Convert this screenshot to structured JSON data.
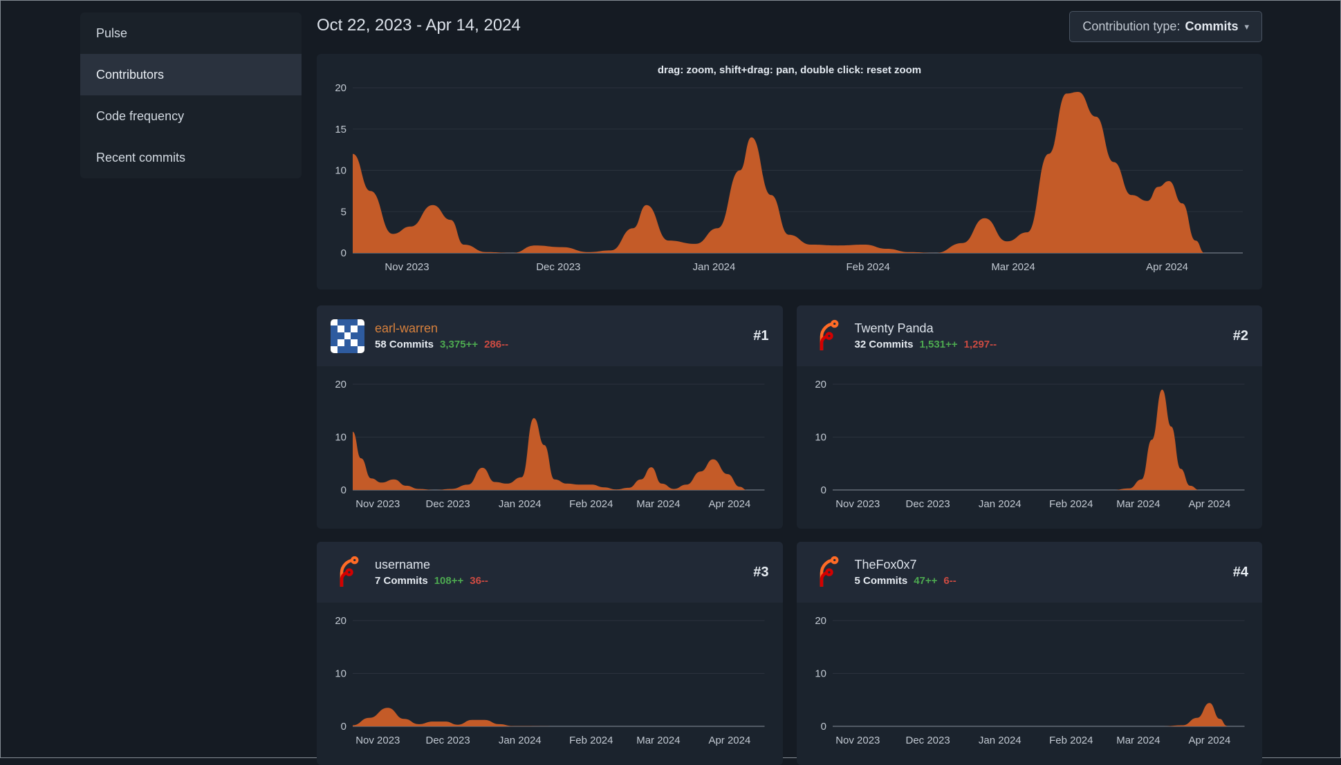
{
  "sidebar": {
    "items": [
      {
        "label": "Pulse",
        "active": false
      },
      {
        "label": "Contributors",
        "active": true
      },
      {
        "label": "Code frequency",
        "active": false
      },
      {
        "label": "Recent commits",
        "active": false
      }
    ]
  },
  "header": {
    "date_range": "Oct 22, 2023 - Apr 14, 2024",
    "contribution_type": {
      "label": "Contribution type:",
      "value": "Commits"
    }
  },
  "main_chart": {
    "hint": "drag: zoom, shift+drag: pan, double click: reset zoom"
  },
  "contributors": [
    {
      "rank": "#1",
      "name": "earl-warren",
      "commits": "58 Commits",
      "additions": "3,375++",
      "deletions": "286--",
      "avatar": "identicon"
    },
    {
      "rank": "#2",
      "name": "Twenty Panda",
      "commits": "32 Commits",
      "additions": "1,531++",
      "deletions": "1,297--",
      "avatar": "forgejo-logo"
    },
    {
      "rank": "#3",
      "name": "username",
      "commits": "7 Commits",
      "additions": "108++",
      "deletions": "36--",
      "avatar": "forgejo-logo"
    },
    {
      "rank": "#4",
      "name": "TheFox0x7",
      "commits": "5 Commits",
      "additions": "47++",
      "deletions": "6--",
      "avatar": "forgejo-logo"
    }
  ],
  "avatars": {
    "identicon": {
      "bg": "#2e5b9f",
      "fg": "#ffffff",
      "pattern": [
        "10001",
        "01010",
        "00100",
        "01010",
        "10001"
      ]
    }
  },
  "colors": {
    "page_bg": "#151b23",
    "card_bg": "#1b232d",
    "card_header_bg": "#212936",
    "sidebar_bg": "#1a2129",
    "sidebar_active_bg": "#2a323e",
    "button_bg": "#222a35",
    "button_border": "#4a5462",
    "text_primary": "#dde3eb",
    "text_secondary": "#c3cad3",
    "grid_line": "#2b323d",
    "axis_line": "#8a929d",
    "axis_label": "#c3cad3",
    "chart_area": "#c45b28",
    "link_orange": "#d8813d",
    "additions_green": "#4da950",
    "deletions_red": "#cc4b42",
    "rank_text": "#e9eef4",
    "forgejo_orange": "#ff6b26",
    "forgejo_red": "#d40000"
  },
  "chart_data": [
    {
      "type": "area",
      "title": "Repository commit activity Oct 22, 2023 - Apr 14, 2024 (commits per week)",
      "ylim": [
        0,
        20
      ],
      "y_ticks": [
        0,
        5,
        10,
        15,
        20
      ],
      "grid": true,
      "x_ticks": [
        {
          "pos": 0.061,
          "label": "Nov 2023"
        },
        {
          "pos": 0.231,
          "label": "Dec 2023"
        },
        {
          "pos": 0.406,
          "label": "Jan 2024"
        },
        {
          "pos": 0.579,
          "label": "Feb 2024"
        },
        {
          "pos": 0.742,
          "label": "Mar 2024"
        },
        {
          "pos": 0.915,
          "label": "Apr 2024"
        }
      ],
      "points": [
        [
          0,
          12
        ],
        [
          0.02,
          7.5
        ],
        [
          0.045,
          2.3
        ],
        [
          0.065,
          3.2
        ],
        [
          0.09,
          5.8
        ],
        [
          0.11,
          4
        ],
        [
          0.125,
          1
        ],
        [
          0.15,
          0.1
        ],
        [
          0.18,
          0
        ],
        [
          0.205,
          0.9
        ],
        [
          0.235,
          0.7
        ],
        [
          0.265,
          0.1
        ],
        [
          0.29,
          0.3
        ],
        [
          0.315,
          3
        ],
        [
          0.33,
          5.8
        ],
        [
          0.355,
          1.5
        ],
        [
          0.385,
          1.1
        ],
        [
          0.41,
          3
        ],
        [
          0.435,
          10
        ],
        [
          0.448,
          14
        ],
        [
          0.47,
          7
        ],
        [
          0.49,
          2.2
        ],
        [
          0.515,
          1
        ],
        [
          0.545,
          0.9
        ],
        [
          0.575,
          1
        ],
        [
          0.6,
          0.5
        ],
        [
          0.625,
          0.1
        ],
        [
          0.655,
          0
        ],
        [
          0.685,
          1.2
        ],
        [
          0.71,
          4.2
        ],
        [
          0.735,
          1.4
        ],
        [
          0.758,
          2.5
        ],
        [
          0.782,
          12
        ],
        [
          0.802,
          19.3
        ],
        [
          0.815,
          19.5
        ],
        [
          0.835,
          16.5
        ],
        [
          0.855,
          11
        ],
        [
          0.875,
          7
        ],
        [
          0.893,
          6.3
        ],
        [
          0.905,
          8
        ],
        [
          0.917,
          8.7
        ],
        [
          0.932,
          6
        ],
        [
          0.947,
          1.5
        ],
        [
          0.957,
          0
        ]
      ]
    },
    {
      "type": "area",
      "title": "earl-warren weekly commits",
      "ylim": [
        0,
        20
      ],
      "y_ticks": [
        0,
        10,
        20
      ],
      "grid": true,
      "x_ticks": [
        {
          "pos": 0.061,
          "label": "Nov 2023"
        },
        {
          "pos": 0.231,
          "label": "Dec 2023"
        },
        {
          "pos": 0.406,
          "label": "Jan 2024"
        },
        {
          "pos": 0.579,
          "label": "Feb 2024"
        },
        {
          "pos": 0.742,
          "label": "Mar 2024"
        },
        {
          "pos": 0.915,
          "label": "Apr 2024"
        }
      ],
      "points": [
        [
          0,
          11
        ],
        [
          0.02,
          6
        ],
        [
          0.045,
          2.2
        ],
        [
          0.07,
          1.4
        ],
        [
          0.1,
          2
        ],
        [
          0.13,
          0.8
        ],
        [
          0.16,
          0.2
        ],
        [
          0.2,
          0
        ],
        [
          0.24,
          0.2
        ],
        [
          0.28,
          1
        ],
        [
          0.315,
          4.2
        ],
        [
          0.345,
          1.5
        ],
        [
          0.375,
          1.2
        ],
        [
          0.41,
          2.4
        ],
        [
          0.44,
          13.6
        ],
        [
          0.465,
          8.5
        ],
        [
          0.49,
          2
        ],
        [
          0.52,
          1.2
        ],
        [
          0.55,
          1
        ],
        [
          0.58,
          1
        ],
        [
          0.61,
          0.5
        ],
        [
          0.64,
          0.1
        ],
        [
          0.67,
          0.4
        ],
        [
          0.7,
          2
        ],
        [
          0.725,
          4.3
        ],
        [
          0.75,
          1.2
        ],
        [
          0.78,
          0.2
        ],
        [
          0.81,
          1
        ],
        [
          0.845,
          3.5
        ],
        [
          0.875,
          5.8
        ],
        [
          0.91,
          3
        ],
        [
          0.94,
          0.6
        ],
        [
          0.957,
          0
        ]
      ]
    },
    {
      "type": "area",
      "title": "Twenty Panda weekly commits",
      "ylim": [
        0,
        20
      ],
      "y_ticks": [
        0,
        10,
        20
      ],
      "grid": true,
      "x_ticks": [
        {
          "pos": 0.061,
          "label": "Nov 2023"
        },
        {
          "pos": 0.231,
          "label": "Dec 2023"
        },
        {
          "pos": 0.406,
          "label": "Jan 2024"
        },
        {
          "pos": 0.579,
          "label": "Feb 2024"
        },
        {
          "pos": 0.742,
          "label": "Mar 2024"
        },
        {
          "pos": 0.915,
          "label": "Apr 2024"
        }
      ],
      "points": [
        [
          0,
          0
        ],
        [
          0.2,
          0
        ],
        [
          0.4,
          0
        ],
        [
          0.6,
          0
        ],
        [
          0.68,
          0
        ],
        [
          0.72,
          0.3
        ],
        [
          0.75,
          2
        ],
        [
          0.775,
          9.5
        ],
        [
          0.8,
          19
        ],
        [
          0.822,
          12
        ],
        [
          0.845,
          4
        ],
        [
          0.868,
          0.8
        ],
        [
          0.89,
          0
        ],
        [
          0.957,
          0
        ]
      ]
    },
    {
      "type": "area",
      "title": "username weekly commits",
      "ylim": [
        0,
        20
      ],
      "y_ticks": [
        0,
        10,
        20
      ],
      "grid": true,
      "x_ticks": [
        {
          "pos": 0.061,
          "label": "Nov 2023"
        },
        {
          "pos": 0.231,
          "label": "Dec 2023"
        },
        {
          "pos": 0.406,
          "label": "Jan 2024"
        },
        {
          "pos": 0.579,
          "label": "Feb 2024"
        },
        {
          "pos": 0.742,
          "label": "Mar 2024"
        },
        {
          "pos": 0.915,
          "label": "Apr 2024"
        }
      ],
      "points": [
        [
          0,
          0.2
        ],
        [
          0.04,
          1.6
        ],
        [
          0.085,
          3.5
        ],
        [
          0.125,
          1.4
        ],
        [
          0.16,
          0.4
        ],
        [
          0.195,
          0.9
        ],
        [
          0.225,
          0.9
        ],
        [
          0.255,
          0.3
        ],
        [
          0.29,
          1.2
        ],
        [
          0.32,
          1.2
        ],
        [
          0.355,
          0.4
        ],
        [
          0.39,
          0.05
        ],
        [
          0.5,
          0
        ],
        [
          0.7,
          0
        ],
        [
          0.957,
          0
        ]
      ]
    },
    {
      "type": "area",
      "title": "TheFox0x7 weekly commits",
      "ylim": [
        0,
        20
      ],
      "y_ticks": [
        0,
        10,
        20
      ],
      "grid": true,
      "x_ticks": [
        {
          "pos": 0.061,
          "label": "Nov 2023"
        },
        {
          "pos": 0.231,
          "label": "Dec 2023"
        },
        {
          "pos": 0.406,
          "label": "Jan 2024"
        },
        {
          "pos": 0.579,
          "label": "Feb 2024"
        },
        {
          "pos": 0.742,
          "label": "Mar 2024"
        },
        {
          "pos": 0.915,
          "label": "Apr 2024"
        }
      ],
      "points": [
        [
          0,
          0
        ],
        [
          0.3,
          0
        ],
        [
          0.6,
          0
        ],
        [
          0.8,
          0
        ],
        [
          0.85,
          0.2
        ],
        [
          0.885,
          1.6
        ],
        [
          0.915,
          4.4
        ],
        [
          0.94,
          1.4
        ],
        [
          0.957,
          0.1
        ]
      ]
    }
  ]
}
